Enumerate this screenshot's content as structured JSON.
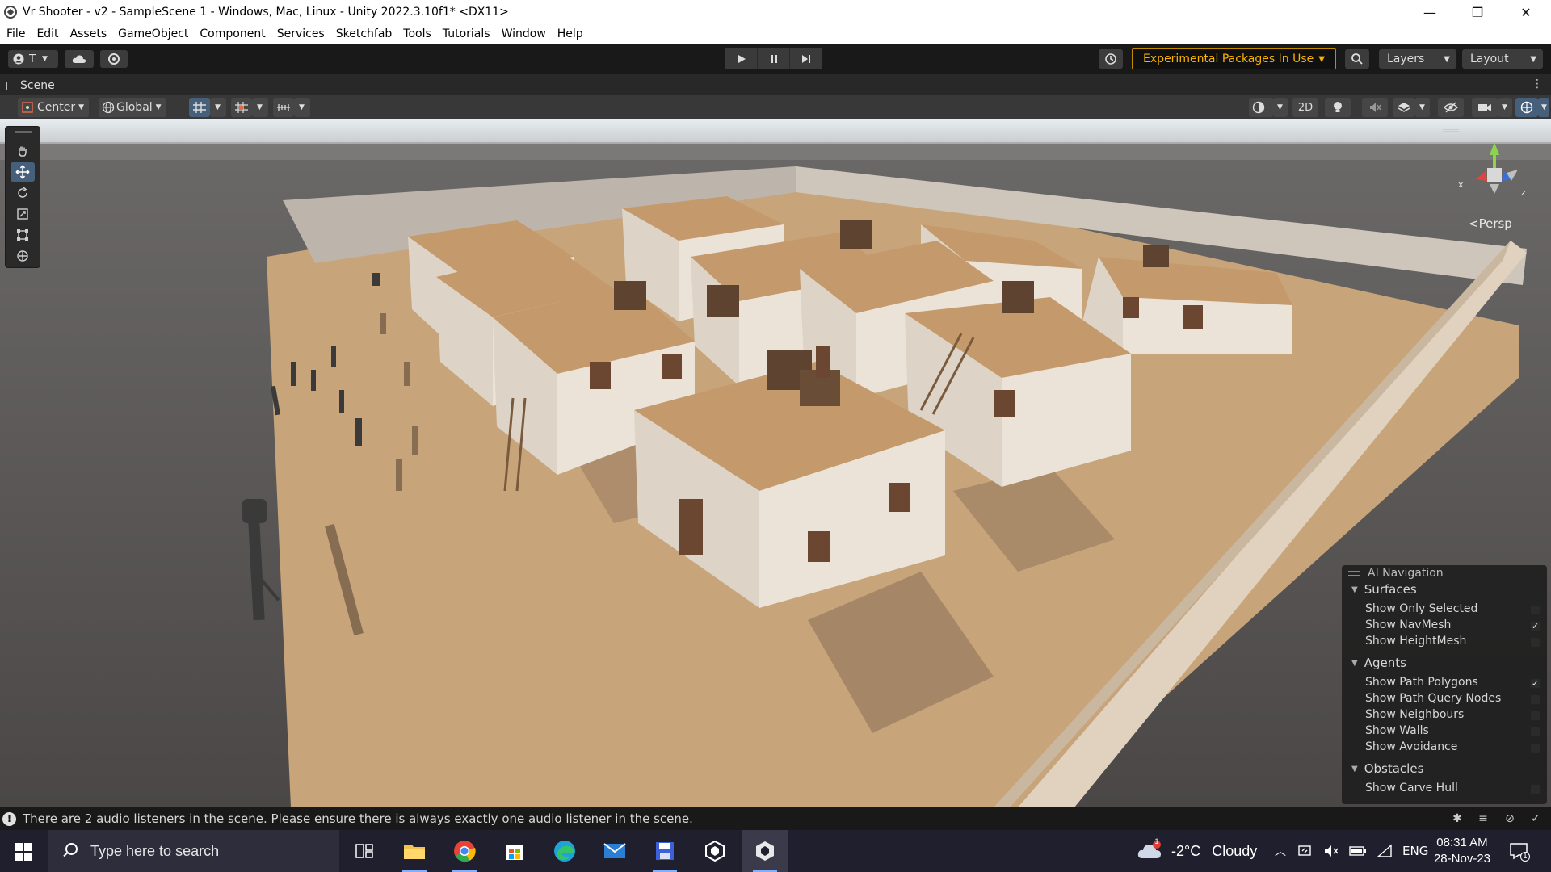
{
  "window": {
    "title": "Vr Shooter - v2 - SampleScene 1 - Windows, Mac, Linux - Unity 2022.3.10f1* <DX11>",
    "controls": [
      "—",
      "❐",
      "✕"
    ]
  },
  "menu": [
    "File",
    "Edit",
    "Assets",
    "GameObject",
    "Component",
    "Services",
    "Sketchfab",
    "Tools",
    "Tutorials",
    "Window",
    "Help"
  ],
  "toolbar": {
    "account_label": "T",
    "experimental_label": "Experimental Packages In Use",
    "layers_label": "Layers",
    "layout_label": "Layout"
  },
  "scene": {
    "tab_label": "Scene",
    "pivot_label": "Center",
    "space_label": "Global",
    "mode_2d_label": "2D",
    "persp_label": "Persp",
    "axis_x": "x",
    "axis_z": "z"
  },
  "ai_navigation": {
    "title": "AI Navigation",
    "sections": [
      {
        "name": "Surfaces",
        "options": [
          {
            "label": "Show Only Selected",
            "checked": false
          },
          {
            "label": "Show NavMesh",
            "checked": true
          },
          {
            "label": "Show HeightMesh",
            "checked": false
          }
        ]
      },
      {
        "name": "Agents",
        "options": [
          {
            "label": "Show Path Polygons",
            "checked": true
          },
          {
            "label": "Show Path Query Nodes",
            "checked": false
          },
          {
            "label": "Show Neighbours",
            "checked": false
          },
          {
            "label": "Show Walls",
            "checked": false
          },
          {
            "label": "Show Avoidance",
            "checked": false
          }
        ]
      },
      {
        "name": "Obstacles",
        "options": [
          {
            "label": "Show Carve Hull",
            "checked": false
          }
        ]
      }
    ]
  },
  "status": {
    "message": "There are 2 audio listeners in the scene. Please ensure there is always exactly one audio listener in the scene."
  },
  "taskbar": {
    "search_placeholder": "Type here to search",
    "weather_temp": "-2°C",
    "weather_desc": "Cloudy",
    "language": "ENG",
    "time": "08:31 AM",
    "date": "28-Nov-23",
    "notification_count": "1",
    "weather_badge": "1"
  },
  "colors": {
    "unity_dark": "#191919",
    "scene_sky": "#dbe3ea",
    "ground": "#4e4b48",
    "sand": "#c7a57c",
    "roof": "#c49a6c",
    "wall": "#e6ddd2",
    "experimental": "#f8b200",
    "select_blue": "#46607c"
  }
}
